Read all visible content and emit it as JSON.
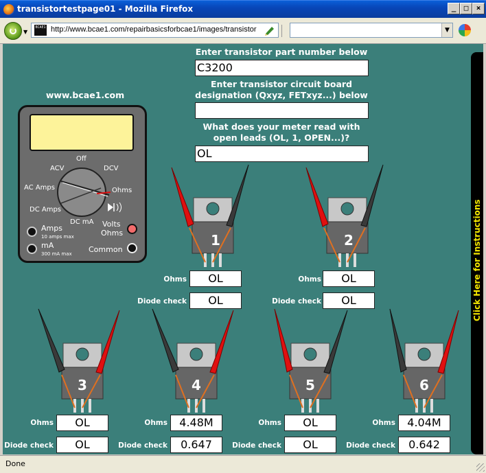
{
  "window": {
    "title": "transistortestpage01 - Mozilla Firefox"
  },
  "nav": {
    "url": "http://www.bcae1.com/repairbasicsforbcae1/images/transistor",
    "favicon": "BCAE1"
  },
  "form": {
    "part_label": "Enter transistor part number below",
    "part_value": "C3200",
    "designation_label_1": "Enter transistor circuit board",
    "designation_label_2": "designation (Qxyz, FETxyz...) below",
    "designation_value": "",
    "open_label_1": "What does your meter read with",
    "open_label_2": "open leads (OL, 1, OPEN...)?",
    "open_value": "OL"
  },
  "meter": {
    "site": "www.bcae1.com",
    "off": "Off",
    "acv": "ACV",
    "dcv": "DCV",
    "ac_amps": "AC Amps",
    "ohms": "Ohms",
    "dc_amps": "DC Amps",
    "dc_ma": "DC mA",
    "amps": "Amps",
    "amps_sub": "10 amps max",
    "ma": "mA",
    "ma_sub": "300 mA max",
    "volts": "Volts",
    "volts_ohms": "Ohms",
    "common": "Common"
  },
  "labels": {
    "ohms": "Ohms",
    "diode": "Diode check"
  },
  "transistors": [
    {
      "num": "1",
      "ohms": "OL",
      "diode": "OL"
    },
    {
      "num": "2",
      "ohms": "OL",
      "diode": "OL"
    },
    {
      "num": "3",
      "ohms": "OL",
      "diode": "OL"
    },
    {
      "num": "4",
      "ohms": "4.48M",
      "diode": "0.647"
    },
    {
      "num": "5",
      "ohms": "OL",
      "diode": "OL"
    },
    {
      "num": "6",
      "ohms": "4.04M",
      "diode": "0.642"
    }
  ],
  "sidebar": {
    "instructions": "Click Here for Instructions"
  },
  "status": {
    "text": "Done"
  },
  "colors": {
    "content_bg": "#3b7f7a",
    "red_probe": "#e01010",
    "black_probe": "#3a3a3a",
    "lead": "#e07020"
  }
}
